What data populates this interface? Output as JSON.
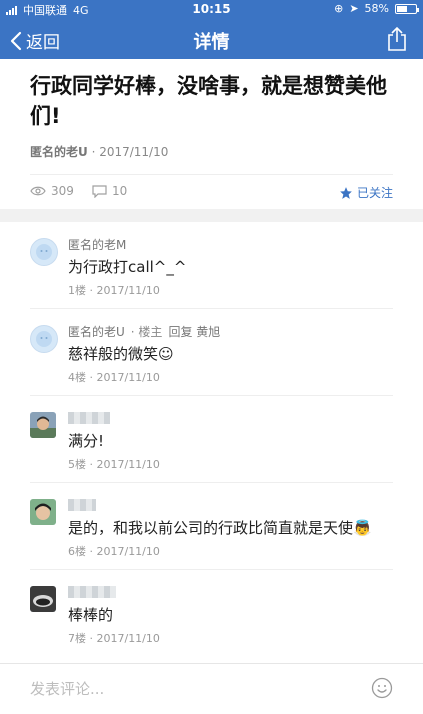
{
  "status": {
    "carrier": "中国联通",
    "network": "4G",
    "time": "10:15",
    "battery": "58%",
    "battery_level": 0.58
  },
  "nav": {
    "back_label": "返回",
    "title": "详情"
  },
  "post": {
    "title": "行政同学好棒，没啥事，就是想赞美他们!",
    "author": "匿名的老U",
    "date": "· 2017/11/10",
    "views": "309",
    "comments": "10",
    "follow_label": "已关注"
  },
  "comments": [
    {
      "name": "匿名的老M",
      "tag": "",
      "reply": "",
      "text": "为行政打call^_^",
      "meta": "1楼 · 2017/11/10"
    },
    {
      "name": "匿名的老U",
      "tag": "· 楼主",
      "reply": "回复 黄旭",
      "text": "慈祥般的微笑☺",
      "meta": "4楼 · 2017/11/10"
    },
    {
      "name": "",
      "tag": "",
      "reply": "",
      "text": "满分!",
      "meta": "5楼 · 2017/11/10"
    },
    {
      "name": "",
      "tag": "",
      "reply": "",
      "text": "是的，和我以前公司的行政比简直就是天使👼",
      "meta": "6楼 · 2017/11/10"
    },
    {
      "name": "",
      "tag": "",
      "reply": "",
      "text": "棒棒的",
      "meta": "7楼 · 2017/11/10"
    }
  ],
  "footer": {
    "placeholder": "发表评论..."
  }
}
